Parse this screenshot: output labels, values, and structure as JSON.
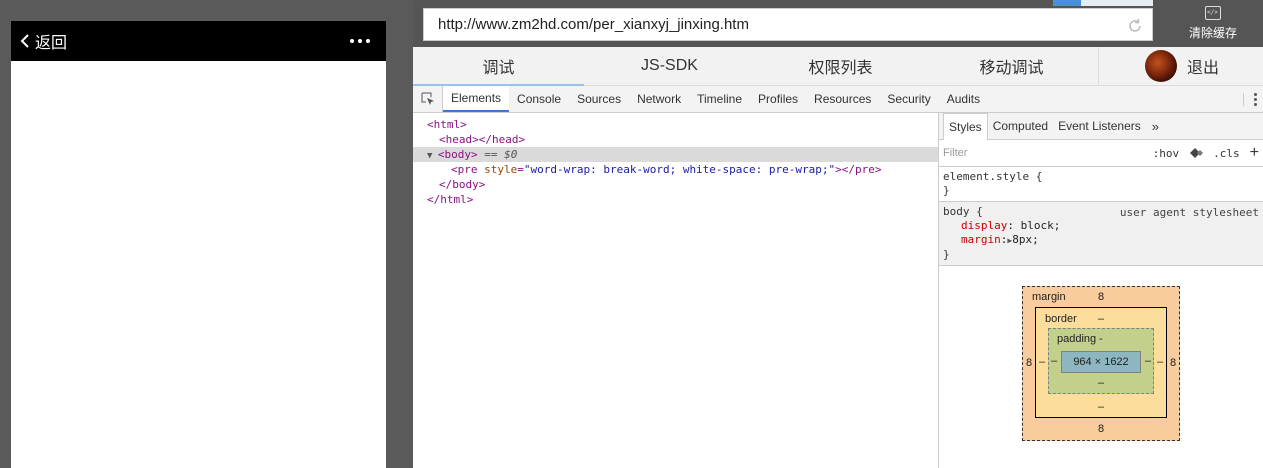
{
  "phone": {
    "back_label": "返回"
  },
  "browser": {
    "url": "http://www.zm2hd.com/per_xianxyj_jinxing.htm",
    "clear_cache_label": "清除缓存"
  },
  "main_tabs": [
    {
      "label": "调试",
      "active": true
    },
    {
      "label": "JS-SDK",
      "active": false
    },
    {
      "label": "权限列表",
      "active": false
    },
    {
      "label": "移动调试",
      "active": false
    }
  ],
  "exit_label": "退出",
  "devtools": {
    "tabs": [
      "Elements",
      "Console",
      "Sources",
      "Network",
      "Timeline",
      "Profiles",
      "Resources",
      "Security",
      "Audits"
    ],
    "active_tab": "Elements",
    "elements": {
      "html_open": "<html>",
      "head": "<head></head>",
      "body_open": "<body>",
      "body_marker": "== $0",
      "pre_open": "<pre",
      "pre_attr_name": "style",
      "pre_attr_value": "\"word-wrap: break-word; white-space: pre-wrap;\"",
      "pre_close": "></pre>",
      "body_close": "</body>",
      "html_close": "</html>"
    },
    "styles": {
      "tabs": [
        "Styles",
        "Computed",
        "Event Listeners"
      ],
      "more": "»",
      "filter_placeholder": "Filter",
      "hov": ":hov",
      "cls": ".cls",
      "plus": "+",
      "element_style": "element.style {",
      "close_brace": "}",
      "body_selector": "body {",
      "ua_source": "user agent stylesheet",
      "props": [
        {
          "name": "display",
          "value": "block;"
        },
        {
          "name": "margin",
          "value": "8px;"
        }
      ]
    },
    "box_model": {
      "margin_label": "margin",
      "margin_top": "8",
      "margin_bottom": "8",
      "margin_left": "8",
      "margin_right": "8",
      "border_label": "border",
      "border_top": "–",
      "border_bottom": "–",
      "border_left": "–",
      "border_right": "–",
      "padding_label": "padding",
      "padding_top": "-",
      "padding_bottom": "–",
      "padding_left": "–",
      "padding_right": "–",
      "content": "964 × 1622"
    }
  }
}
